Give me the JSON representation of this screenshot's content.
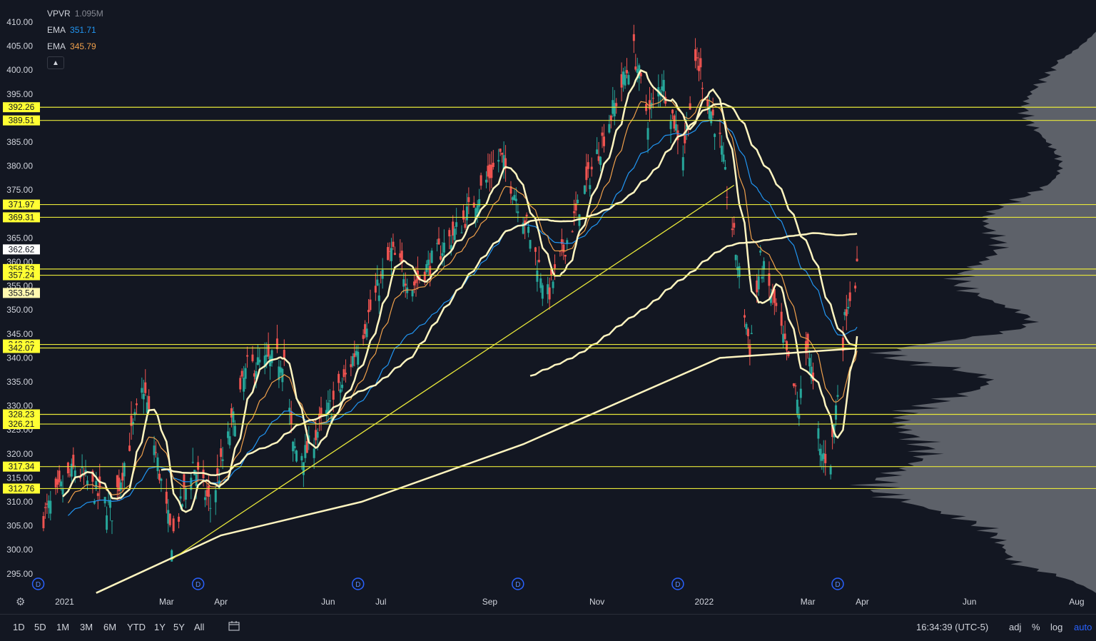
{
  "legend": {
    "vpvr": {
      "name": "VPVR",
      "value": "1.095M"
    },
    "ema1": {
      "name": "EMA",
      "value": "351.71",
      "color": "#2196f3"
    },
    "ema2": {
      "name": "EMA",
      "value": "345.79",
      "color": "#f0a04b"
    }
  },
  "colors": {
    "background": "#131722",
    "up": "#26a69a",
    "down": "#ef5350",
    "level_line": "#e8e83a",
    "sma_line": "#fff5c0",
    "volume_profile": "#6b6e76"
  },
  "chart_data": {
    "type": "candlestick",
    "ylim": [
      291,
      413
    ],
    "yticks": [
      "410.00",
      "405.00",
      "400.00",
      "395.00",
      "385.00",
      "380.00",
      "375.00",
      "365.00",
      "360.00",
      "355.00",
      "350.00",
      "345.00",
      "340.00",
      "335.00",
      "330.00",
      "325.00",
      "320.00",
      "315.00",
      "310.00",
      "305.00",
      "300.00",
      "295.00"
    ],
    "xticks": [
      "2021",
      "Mar",
      "Apr",
      "Jun",
      "Jul",
      "Sep",
      "Nov",
      "2022",
      "Mar",
      "Apr",
      "Jun",
      "Aug"
    ],
    "price_labels": [
      {
        "text": "392.26",
        "value": 392.26,
        "highlight": "yellow"
      },
      {
        "text": "389.51",
        "value": 389.51,
        "highlight": "yellow"
      },
      {
        "text": "371.97",
        "value": 371.97,
        "highlight": "yellow"
      },
      {
        "text": "369.31",
        "value": 369.31,
        "highlight": "yellow"
      },
      {
        "text": "362.62",
        "value": 362.62,
        "highlight": "white"
      },
      {
        "text": "358.53",
        "value": 358.53,
        "highlight": "yellow"
      },
      {
        "text": "357.24",
        "value": 357.24,
        "highlight": "yellow"
      },
      {
        "text": "353.54",
        "value": 353.54,
        "highlight": "lightyellow"
      },
      {
        "text": "342.80",
        "value": 342.8,
        "highlight": "yellow"
      },
      {
        "text": "342.07",
        "value": 342.07,
        "highlight": "yellow"
      },
      {
        "text": "328.23",
        "value": 328.23,
        "highlight": "yellow"
      },
      {
        "text": "326.21",
        "value": 326.21,
        "highlight": "yellow"
      },
      {
        "text": "317.34",
        "value": 317.34,
        "highlight": "yellow"
      },
      {
        "text": "312.76",
        "value": 312.76,
        "highlight": "yellow"
      }
    ],
    "horizontal_levels": [
      392.26,
      389.51,
      371.97,
      369.31,
      358.53,
      357.24,
      342.8,
      342.07,
      328.23,
      326.21,
      317.34,
      312.76
    ],
    "trendline": {
      "start": {
        "date": "2021-03-04",
        "price": 298.0
      },
      "end": {
        "date": "2022-01-18",
        "price": 376.0
      }
    },
    "dividend_markers": [
      "2020-12-18",
      "2021-03-19",
      "2021-06-18",
      "2021-09-17",
      "2021-12-17",
      "2022-03-18"
    ],
    "x_date_range": [
      "2020-12-19",
      "2022-08-12"
    ],
    "close_anchors": [
      {
        "date": "2020-12-21",
        "price": 307.0
      },
      {
        "date": "2021-01-08",
        "price": 317.0
      },
      {
        "date": "2021-01-29",
        "price": 308.0
      },
      {
        "date": "2021-02-16",
        "price": 334.0
      },
      {
        "date": "2021-03-04",
        "price": 302.0
      },
      {
        "date": "2021-03-16",
        "price": 318.0
      },
      {
        "date": "2021-03-26",
        "price": 309.0
      },
      {
        "date": "2021-04-16",
        "price": 338.0
      },
      {
        "date": "2021-05-07",
        "price": 340.0
      },
      {
        "date": "2021-05-12",
        "price": 321.0
      },
      {
        "date": "2021-05-19",
        "price": 320.0
      },
      {
        "date": "2021-06-10",
        "price": 335.0
      },
      {
        "date": "2021-07-07",
        "price": 362.0
      },
      {
        "date": "2021-07-19",
        "price": 355.0
      },
      {
        "date": "2021-08-16",
        "price": 368.0
      },
      {
        "date": "2021-09-07",
        "price": 382.0
      },
      {
        "date": "2021-09-20",
        "price": 370.0
      },
      {
        "date": "2021-10-04",
        "price": 353.0
      },
      {
        "date": "2021-10-22",
        "price": 372.0
      },
      {
        "date": "2021-11-22",
        "price": 404.0
      },
      {
        "date": "2021-11-30",
        "price": 390.0
      },
      {
        "date": "2021-12-08",
        "price": 398.0
      },
      {
        "date": "2021-12-20",
        "price": 383.0
      },
      {
        "date": "2021-12-28",
        "price": 402.0
      },
      {
        "date": "2022-01-10",
        "price": 385.0
      },
      {
        "date": "2022-01-27",
        "price": 342.0
      },
      {
        "date": "2022-02-02",
        "price": 360.0
      },
      {
        "date": "2022-02-11",
        "price": 350.0
      },
      {
        "date": "2022-02-24",
        "price": 329.0
      },
      {
        "date": "2022-03-01",
        "price": 344.0
      },
      {
        "date": "2022-03-08",
        "price": 320.0
      },
      {
        "date": "2022-03-14",
        "price": 319.0
      },
      {
        "date": "2022-03-23",
        "price": 351.0
      },
      {
        "date": "2022-03-29",
        "price": 358.0
      }
    ]
  },
  "toolbar": {
    "ranges": [
      "1D",
      "5D",
      "1M",
      "3M",
      "6M",
      "YTD",
      "1Y",
      "5Y",
      "All"
    ],
    "time": "16:34:39 (UTC-5)",
    "right_buttons": [
      "adj",
      "%",
      "log",
      "auto"
    ]
  }
}
